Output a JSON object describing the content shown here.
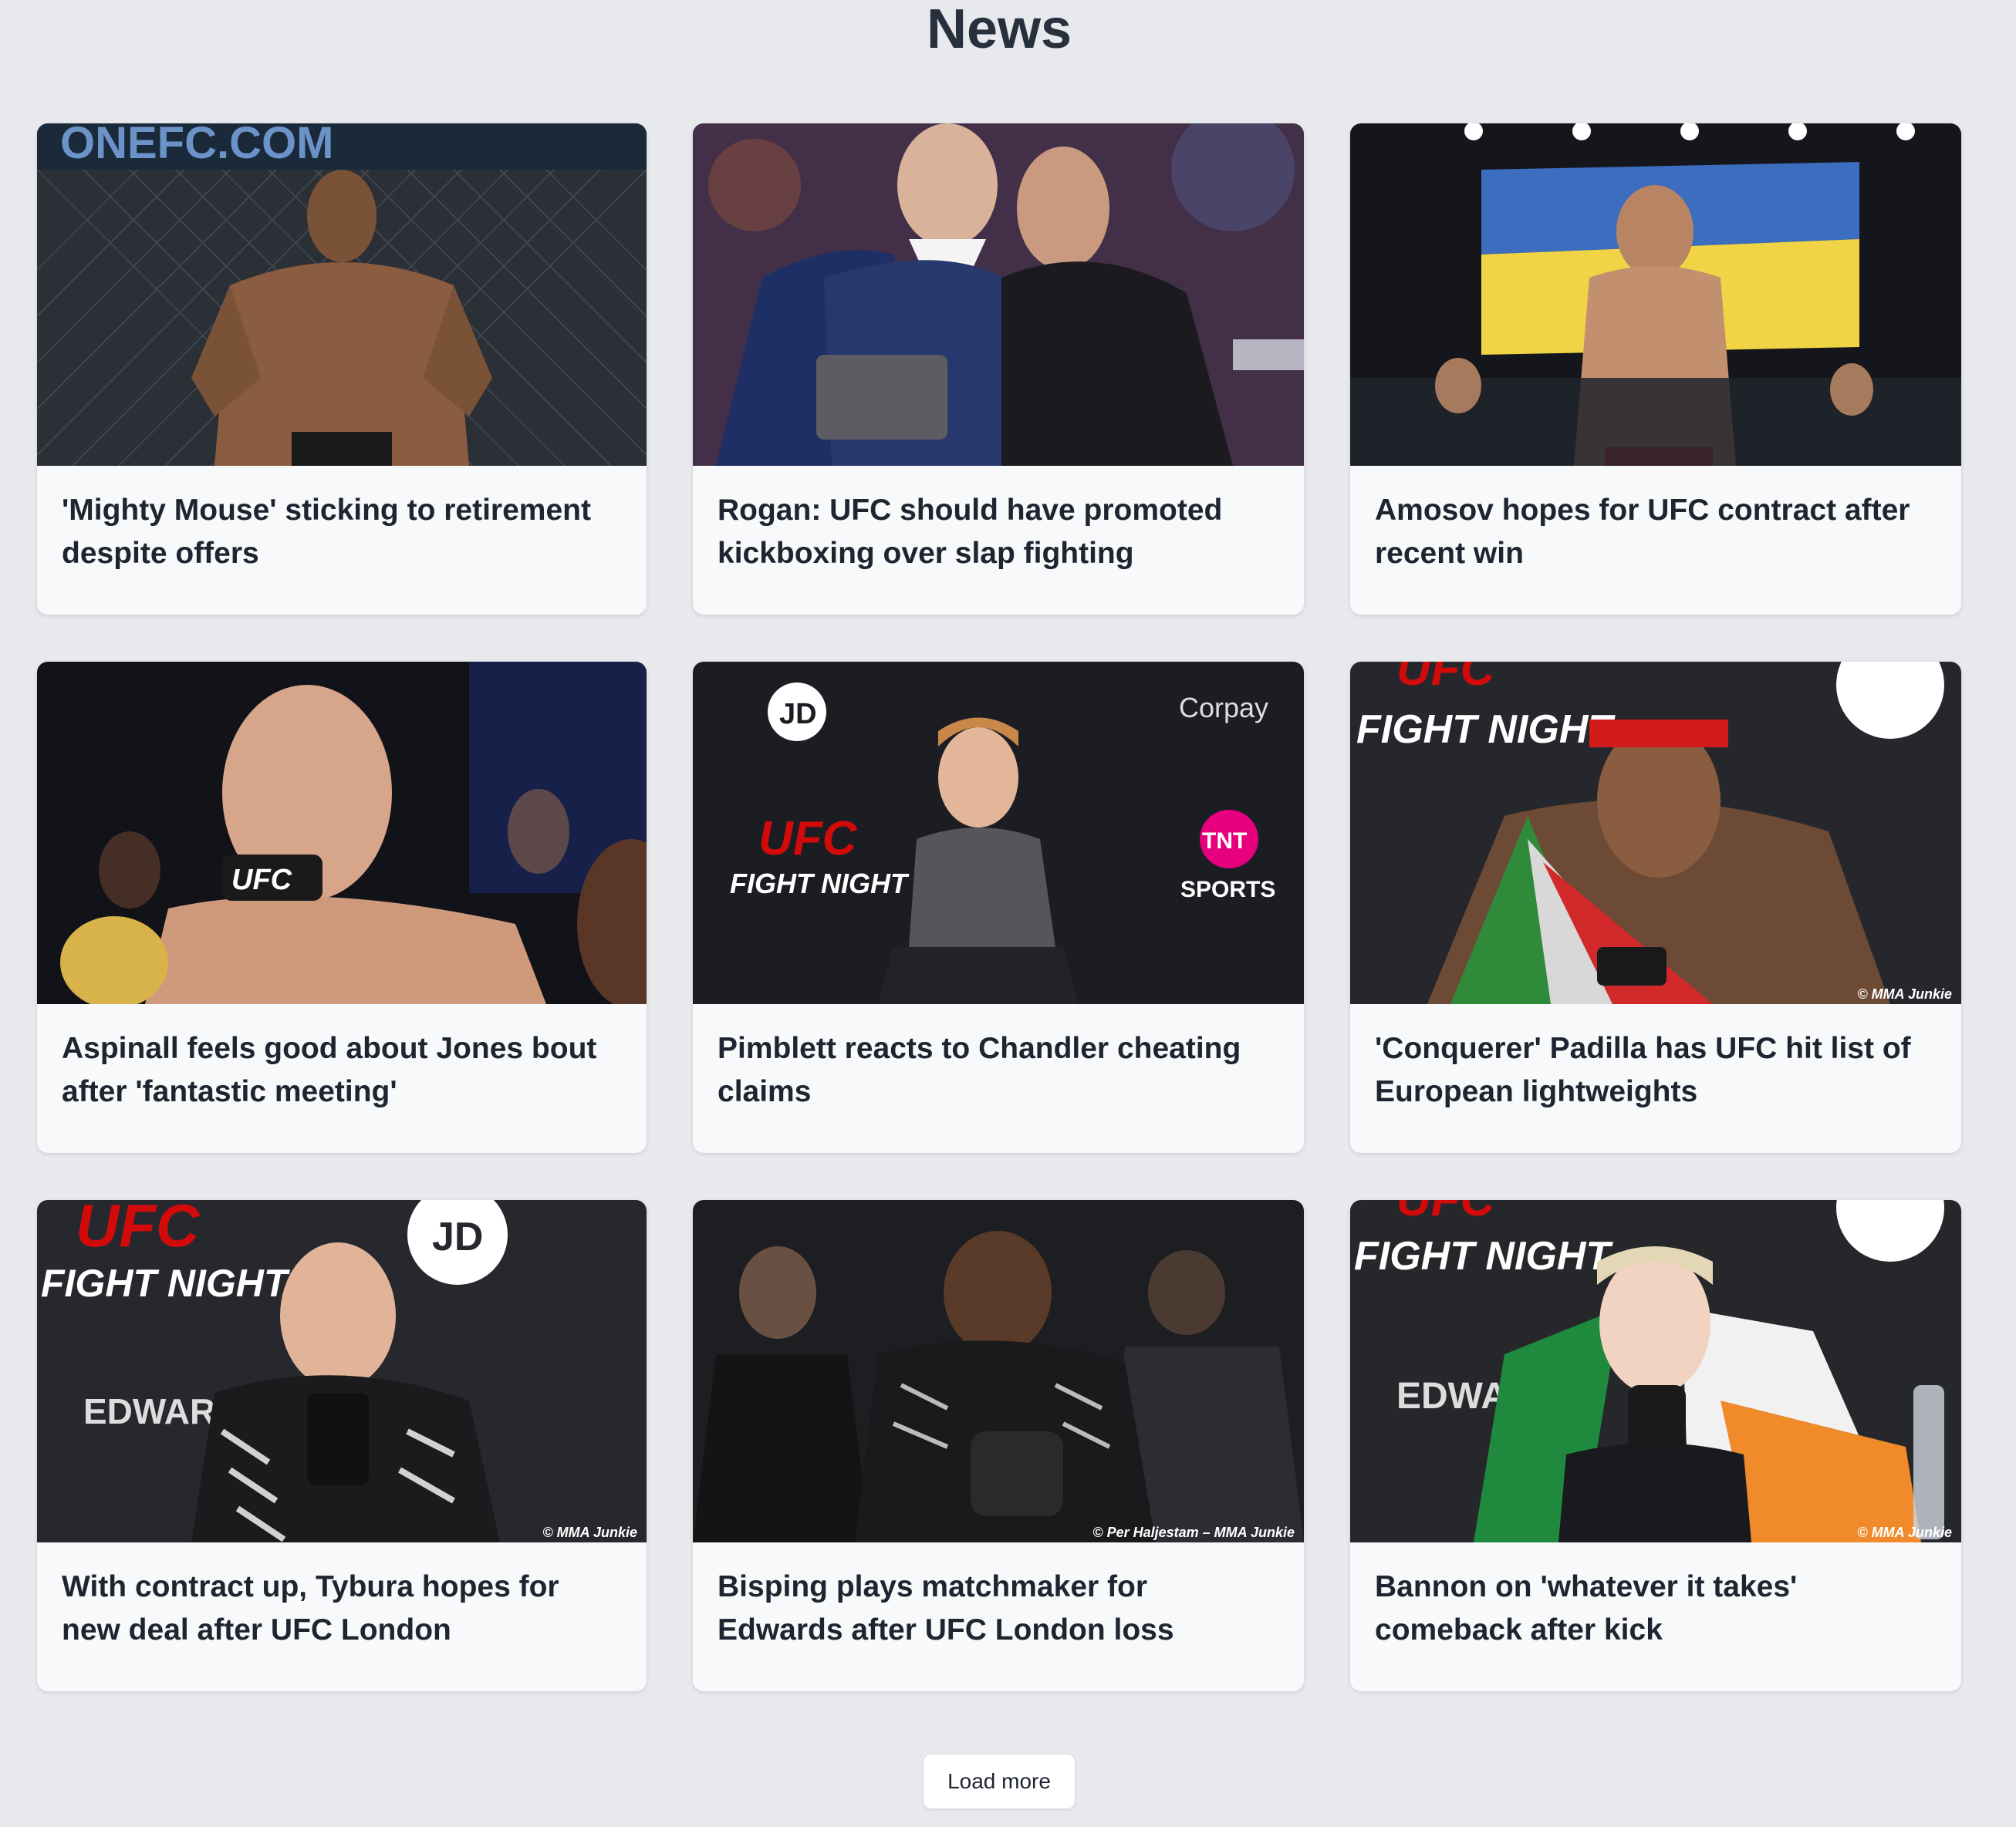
{
  "page": {
    "title": "News"
  },
  "articles": [
    {
      "headline": "'Mighty Mouse' sticking to retirement despite offers",
      "image_alt": "Fighter standing in cage with ONEFC.COM banner",
      "image_text": "ONEFC.COM",
      "watermark": ""
    },
    {
      "headline": "Rogan: UFC should have promoted kickboxing over slap fighting",
      "image_alt": "Two men in suits embracing cageside",
      "image_text": "",
      "watermark": ""
    },
    {
      "headline": "Amosov hopes for UFC contract after recent win",
      "image_alt": "Fighter holding Ukrainian flag in cage",
      "image_text": "",
      "watermark": ""
    },
    {
      "headline": "Aspinall feels good about Jones bout after 'fantastic meeting'",
      "image_alt": "Fighter speaking into UFC microphone",
      "image_text": "UFC",
      "watermark": ""
    },
    {
      "headline": "Pimblett reacts to Chandler cheating claims",
      "image_alt": "Fighter seated at UFC Fight Night press event",
      "image_text": "UFC FIGHT NIGHT",
      "image_sub": "TNT SPORTS",
      "watermark": ""
    },
    {
      "headline": "'Conquerer' Padilla has UFC hit list of European lightweights",
      "image_alt": "Fighter with flag at UFC Fight Night press conference",
      "image_text": "FIGHT NIGHT",
      "watermark": "© MMA Junkie"
    },
    {
      "headline": "With contract up, Tybura hopes for new deal after UFC London",
      "image_alt": "Fighter at UFC Fight Night press conference",
      "image_text": "UFC FIGHT NIGHT",
      "watermark": "© MMA Junkie"
    },
    {
      "headline": "Bisping plays matchmaker for Edwards after UFC London loss",
      "image_alt": "Fighter looking down after bout",
      "image_text": "",
      "watermark": "© Per Haljestam – MMA Junkie"
    },
    {
      "headline": "Bannon on 'whatever it takes' comeback after kick",
      "image_alt": "Fighter with Irish flag at UFC Fight Night press conference",
      "image_text": "FIGHT NIGHT",
      "watermark": "© MMA Junkie"
    }
  ],
  "pagination": {
    "load_more_label": "Load more"
  },
  "colors": {
    "background": "#e8e9ed",
    "card": "#f8f9fb",
    "text": "#1f2530",
    "ufc_red": "#d20a0a"
  }
}
